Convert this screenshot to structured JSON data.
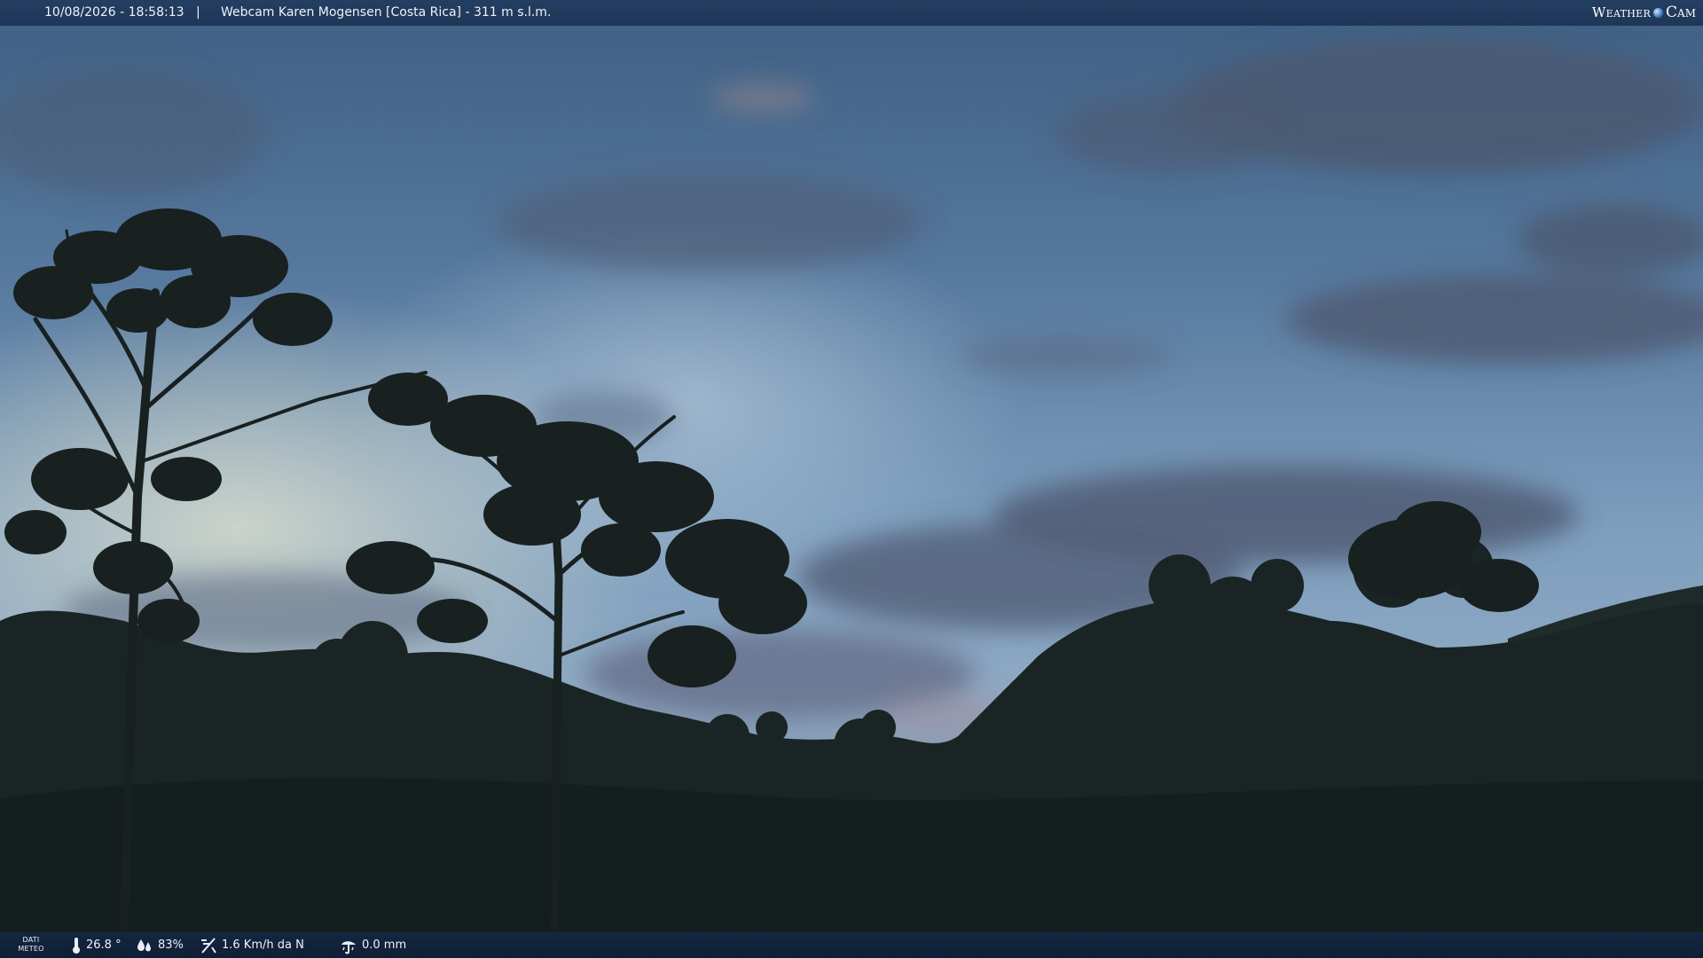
{
  "overlay": {
    "datetime": "10/08/2026 - 18:58:13",
    "separator": "|",
    "title": "Webcam Karen Mogensen [Costa Rica] - 311 m s.l.m.",
    "logo_left": "Weather",
    "logo_right": "Cam"
  },
  "weather": {
    "label_line1": "DATI",
    "label_line2": "METEO",
    "temperature": "26.8 °",
    "humidity": "83%",
    "wind": "1.6 Km/h da N",
    "rain": "0.0 mm"
  },
  "icons": {
    "temperature": "thermometer-icon",
    "humidity": "humidity-drops-icon",
    "wind": "wind-vane-icon",
    "rain": "rain-gauge-icon"
  }
}
